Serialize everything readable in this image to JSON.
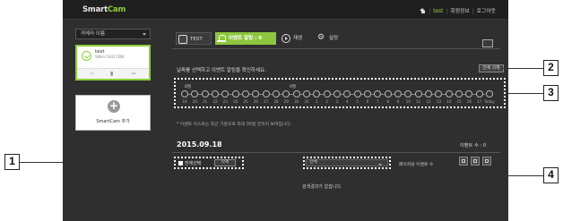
{
  "header": {
    "logo": "Smart",
    "logo_accent": "Cam",
    "user": "test",
    "nav": [
      "회원정보",
      "로그아웃"
    ]
  },
  "sidebar": {
    "sort_label": "카메라 이름",
    "camera": {
      "name": "test",
      "model": "SNH-C6417BN"
    },
    "add_label": "SmartCam 추가"
  },
  "tabs": [
    {
      "label": "TEST"
    },
    {
      "label": "이벤트 알림 : 0"
    },
    {
      "label": "재생"
    },
    {
      "label": "설정"
    }
  ],
  "instruction": "날짜를 선택하고 이벤트 알림을 확인하세요.",
  "all_delete_label": "전체 삭제",
  "timeline": {
    "months": [
      "8월",
      "9월"
    ],
    "days": [
      "19",
      "20",
      "21",
      "22",
      "23",
      "24",
      "25",
      "26",
      "27",
      "28",
      "29",
      "30",
      "31",
      "1",
      "2",
      "3",
      "4",
      "5",
      "6",
      "7",
      "8",
      "9",
      "10",
      "11",
      "12",
      "13",
      "14",
      "15",
      "16",
      "17",
      "Today"
    ]
  },
  "note": "* 이벤트 리스트는 최근 기준으로 최대 30일 전까지 보여집니다.",
  "list": {
    "date": "2015.09.18",
    "count_label": "이벤트 수 : 0",
    "select_all": "전체선택",
    "delete_btn": "삭제",
    "filter_value": "전체",
    "per_page_label": "페이지당 이벤트 수",
    "empty_msg": "검색결과가 없습니다."
  },
  "callouts": [
    "1",
    "2",
    "3",
    "4"
  ],
  "colors": {
    "accent": "#8cc63e",
    "panel": "#2f2f2f",
    "topbar": "#1f1f1f"
  }
}
